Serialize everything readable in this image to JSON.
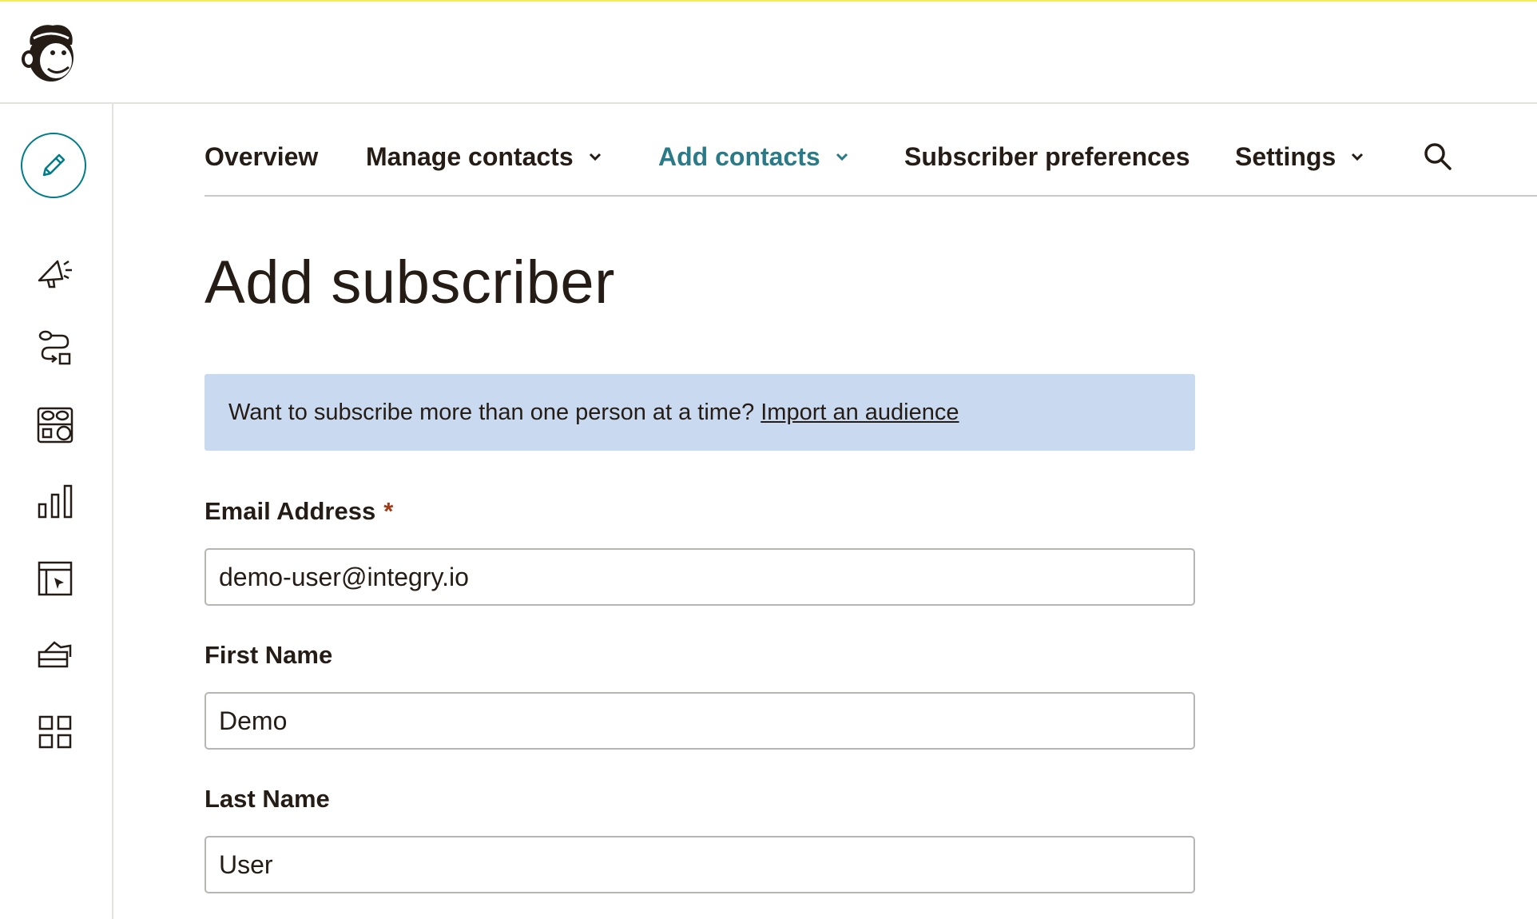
{
  "app": {
    "logo_icon": "mailchimp-freddie-logo",
    "accent_color": "#007c89",
    "banner_color": "#c9d9ef"
  },
  "sidebar": {
    "create_icon": "pencil-icon",
    "items": [
      {
        "icon": "megaphone-icon"
      },
      {
        "icon": "automation-flow-icon"
      },
      {
        "icon": "audience-people-icon"
      },
      {
        "icon": "bar-chart-icon"
      },
      {
        "icon": "website-cursor-icon"
      },
      {
        "icon": "content-studio-icon"
      },
      {
        "icon": "grid-apps-icon"
      }
    ]
  },
  "tabs": {
    "overview": "Overview",
    "manage_contacts": "Manage contacts",
    "add_contacts": "Add contacts",
    "subscriber_preferences": "Subscriber preferences",
    "settings": "Settings",
    "active_tab": "Add contacts"
  },
  "page": {
    "title": "Add subscriber"
  },
  "banner": {
    "text": "Want to subscribe more than one person at a time?",
    "link": "Import an audience"
  },
  "form": {
    "email": {
      "label": "Email Address",
      "required_mark": "*",
      "value": "demo-user@integry.io"
    },
    "first_name": {
      "label": "First Name",
      "value": "Demo"
    },
    "last_name": {
      "label": "Last Name",
      "value": "User"
    }
  }
}
